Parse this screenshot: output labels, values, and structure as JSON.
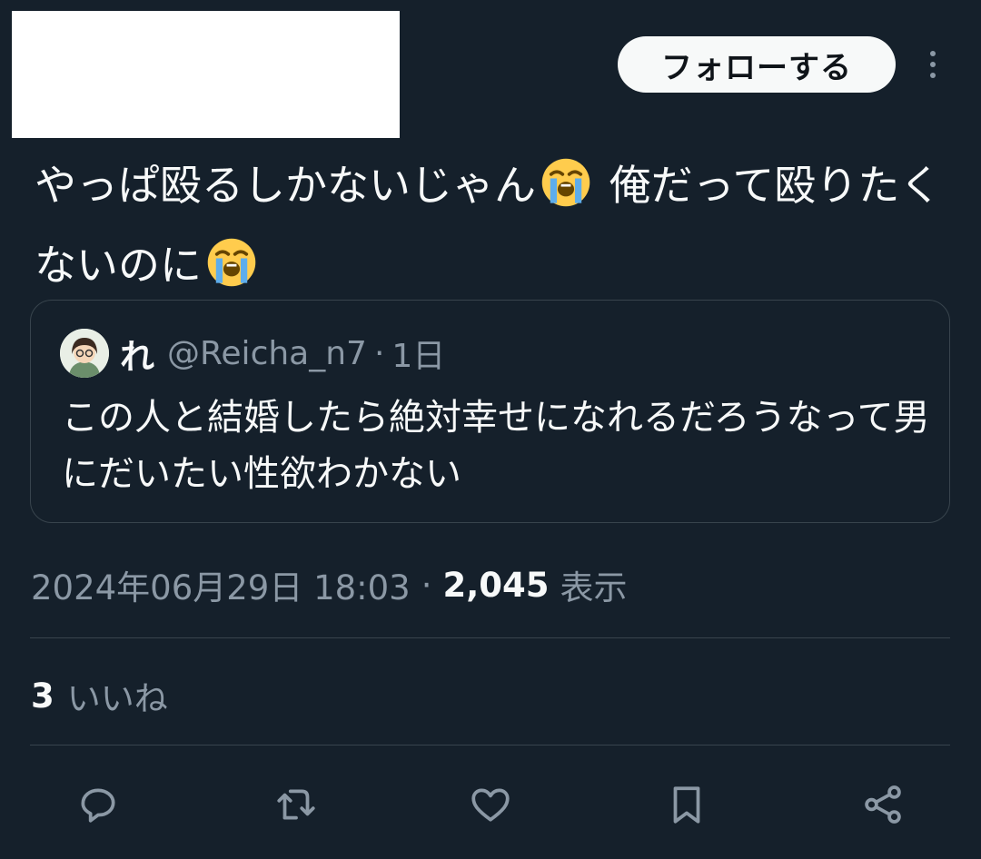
{
  "header": {
    "follow_label": "フォローする",
    "more_icon": "more-vertical-icon"
  },
  "tweet": {
    "text_part1": "やっぱ殴るしかないじゃん",
    "text_part2": " 俺だって殴りたくないのに",
    "emoji": "loudly-crying-face-emoji"
  },
  "quote": {
    "display_name": "れ",
    "handle": "@Reicha_n7",
    "separator": "·",
    "time": "1日",
    "text": "この人と結婚したら絶対幸せになれるだろうなって男にだいたい性欲わかない"
  },
  "meta": {
    "timestamp": "2024年06月29日 18:03",
    "separator": "·",
    "views_count": "2,045",
    "views_label": "表示"
  },
  "stats": {
    "likes_count": "3",
    "likes_label": "いいね"
  },
  "actions": [
    "reply-icon",
    "retweet-icon",
    "like-icon",
    "bookmark-icon",
    "share-icon"
  ],
  "colors": {
    "background": "#15202b",
    "text": "#f7f9f9",
    "secondary": "#8b98a5",
    "border": "#38444d"
  }
}
